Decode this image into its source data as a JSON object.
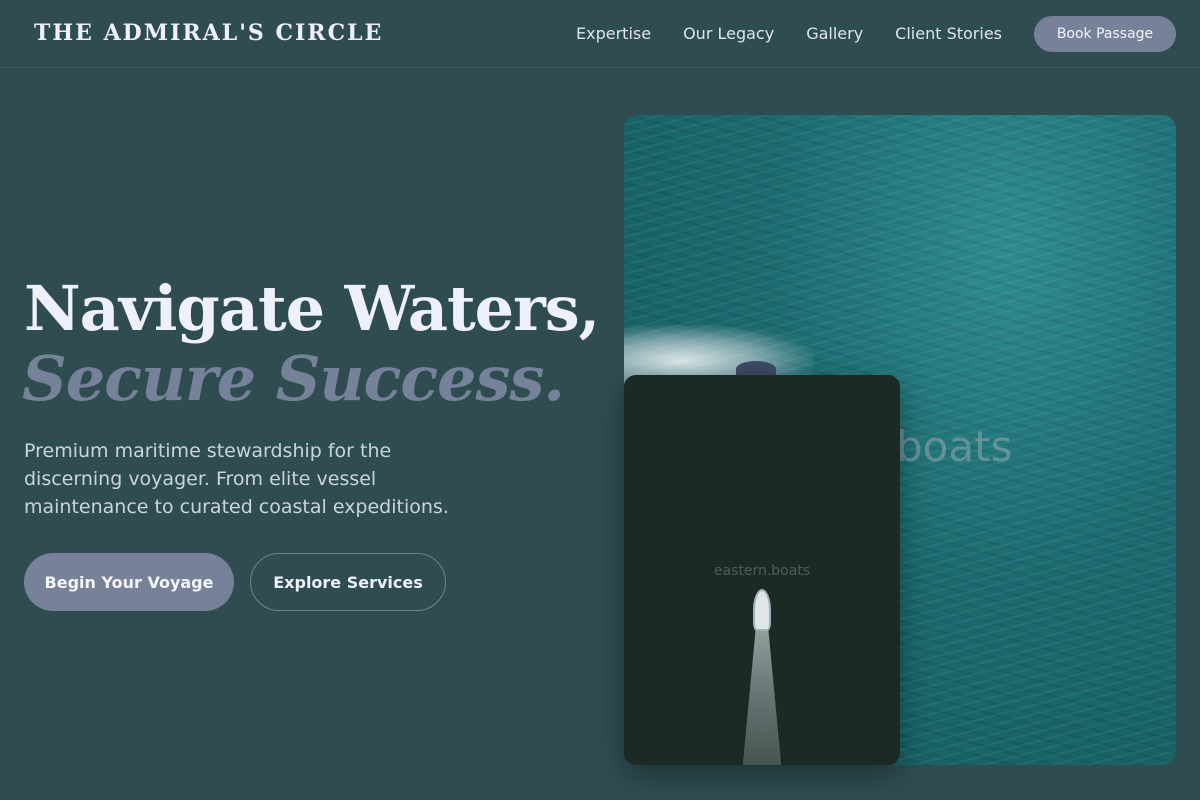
{
  "header": {
    "logo": "THE ADMIRAL'S CIRCLE",
    "nav": [
      "Expertise",
      "Our Legacy",
      "Gallery",
      "Client Stories"
    ],
    "cta": "Book Passage"
  },
  "hero": {
    "title_line1": "Navigate Waters,",
    "title_line2": "Secure Success.",
    "subtitle": "Premium maritime stewardship for the discerning voyager. From elite vessel maintenance to curated coastal expeditions.",
    "primary_button": "Begin Your Voyage",
    "secondary_button": "Explore Services"
  },
  "images": {
    "main_watermark": "n.boats",
    "overlay_watermark": "eastern.boats"
  },
  "colors": {
    "background": "#2f4d51",
    "accent": "#77829a",
    "text": "#eef0fb",
    "muted_title": "#76829a"
  }
}
